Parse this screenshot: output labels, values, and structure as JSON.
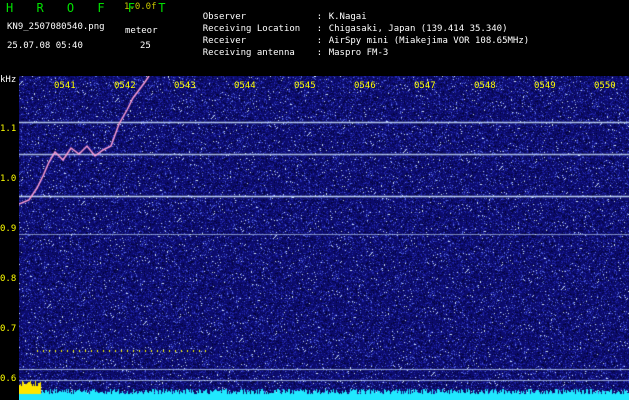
{
  "header": {
    "title": "H R O F F T",
    "version": "1.0.0f",
    "filename": "KN9_2507080540.png",
    "meteor_label": "meteor",
    "datetime": "25.07.08 05:40",
    "meteor_count": "25"
  },
  "info": [
    {
      "key": "Observer",
      "value": "K.Nagai"
    },
    {
      "key": "Receiving Location",
      "value": "Chigasaki, Japan (139.414 35.340)"
    },
    {
      "key": "Receiver",
      "value": "AirSpy mini (Miakejima VOR 108.65MHz)"
    },
    {
      "key": "Receiving antenna",
      "value": "Maspro FM-3"
    }
  ],
  "spectrogram": {
    "y_unit": "kHz",
    "y_ticks": [
      "1.1",
      "1.0",
      "0.9",
      "0.8",
      "0.7",
      "0.6"
    ],
    "x_ticks": [
      "0541",
      "0542",
      "0543",
      "0544",
      "0545",
      "0546",
      "0547",
      "0548",
      "0549",
      "0550"
    ]
  },
  "colors": {
    "background": "#000000",
    "noise_base": "#10107a",
    "header_title": "#00e000",
    "tick_labels": "#ffff00",
    "tone_line": "#cfe6ff",
    "signal_level": "#20e8ff",
    "marker": "#ffff00"
  }
}
